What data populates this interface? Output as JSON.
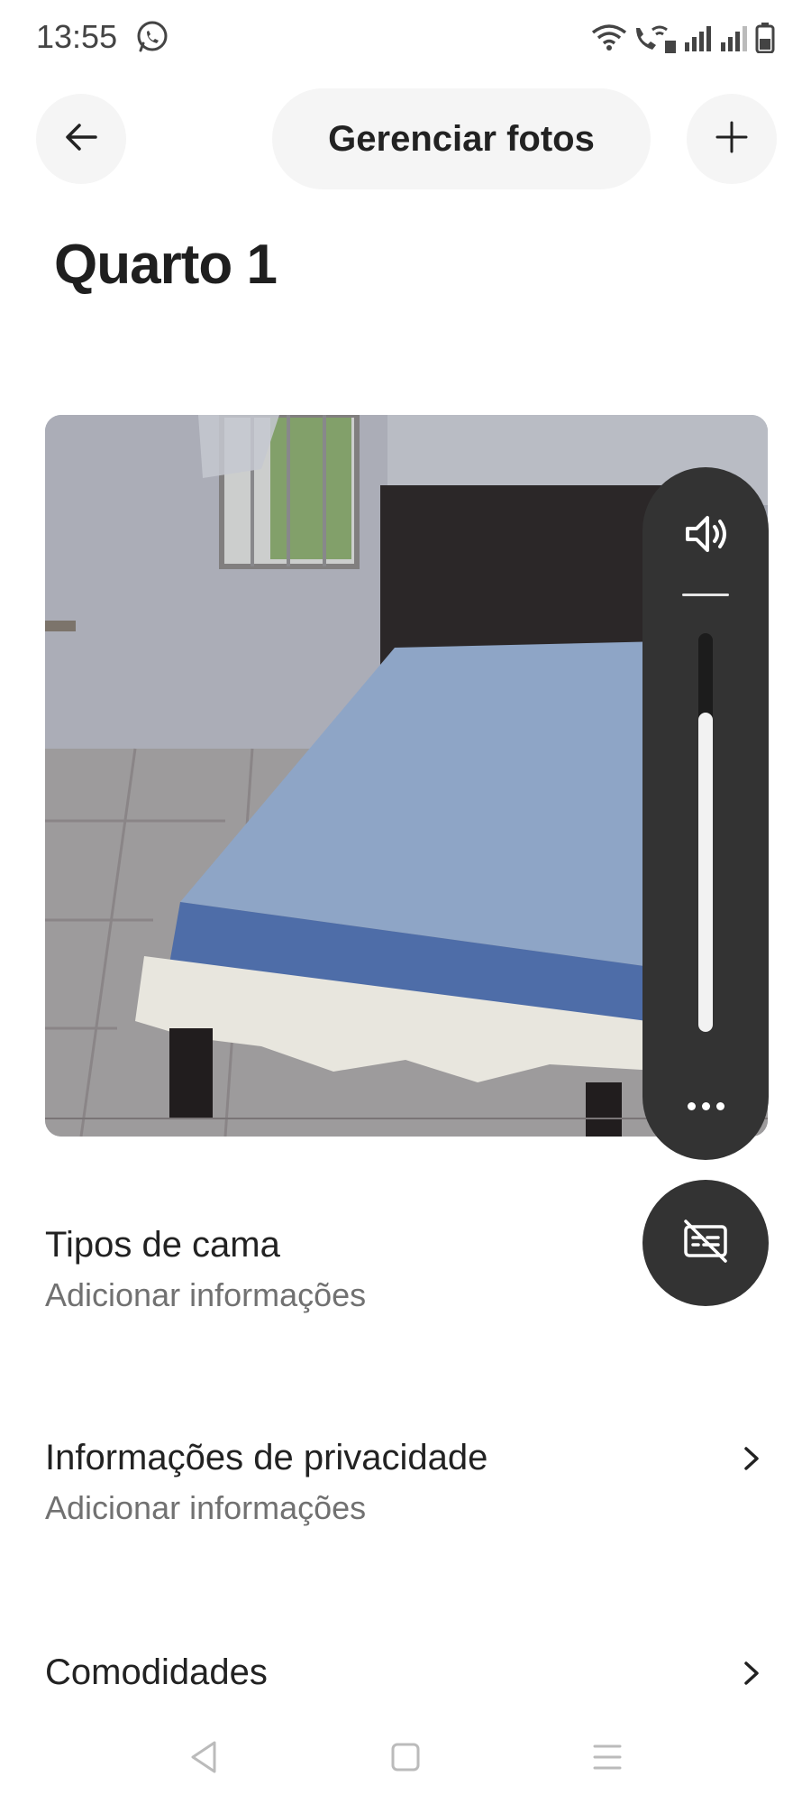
{
  "status_bar": {
    "time": "13:55",
    "icons": [
      "whatsapp-icon",
      "wifi-icon",
      "wifi-calling-icon",
      "signal-icon",
      "signal-icon",
      "battery-icon"
    ]
  },
  "header": {
    "back_icon": "arrow-left-icon",
    "manage_photos_label": "Gerenciar fotos",
    "add_icon": "plus-icon"
  },
  "page": {
    "title": "Quarto 1"
  },
  "volume_overlay": {
    "speaker_icon": "speaker-icon",
    "level": 0.8,
    "more_icon": "more-horizontal-icon",
    "captions_icon": "captions-off-icon"
  },
  "sections": [
    {
      "title": "Tipos de cama",
      "subtitle": "Adicionar informações",
      "has_chevron": false
    },
    {
      "title": "Informações de privacidade",
      "subtitle": "Adicionar informações",
      "has_chevron": true
    },
    {
      "title": "Comodidades",
      "subtitle": "",
      "has_chevron": true
    }
  ],
  "colors": {
    "button_bg": "#f5f5f5",
    "overlay_bg": "#333333",
    "text_primary": "#222222",
    "text_secondary": "#717171"
  },
  "nav_bar": {
    "icons": [
      "nav-back-icon",
      "nav-home-icon",
      "nav-menu-icon"
    ]
  }
}
